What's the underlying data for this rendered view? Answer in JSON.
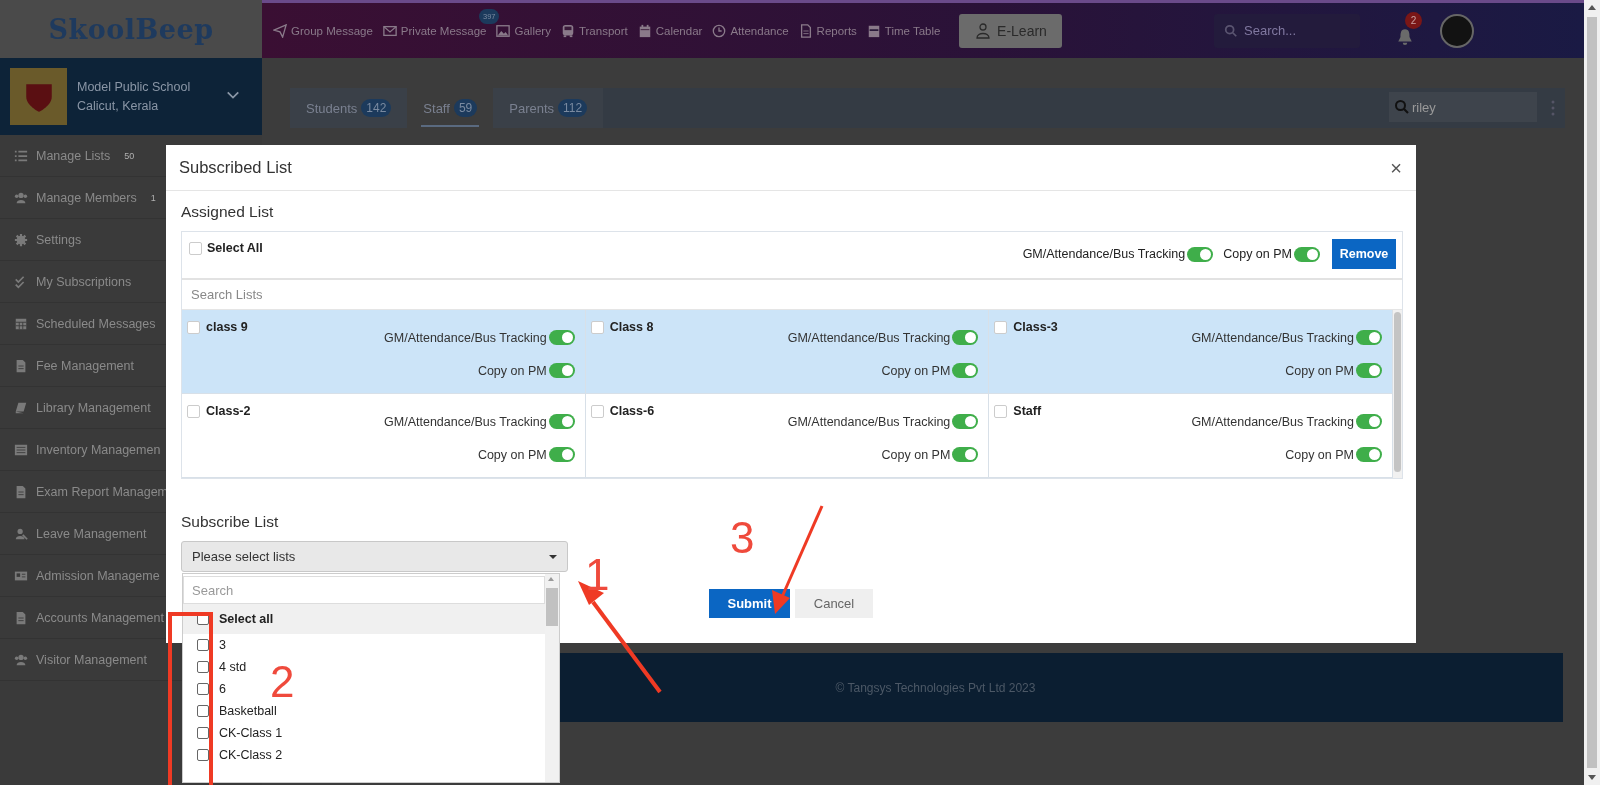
{
  "header": {
    "logo": "SkoolBeep",
    "nav": [
      {
        "label": "Group Message"
      },
      {
        "label": "Private Message",
        "badge": "397"
      },
      {
        "label": "Gallery"
      },
      {
        "label": "Transport"
      },
      {
        "label": "Calendar"
      },
      {
        "label": "Attendance"
      },
      {
        "label": "Reports"
      },
      {
        "label": "Time Table"
      }
    ],
    "elearn": "E-Learn",
    "search": {
      "placeholder": "Search..."
    },
    "notifications": "2"
  },
  "school": {
    "name": "Model Public School",
    "location": "Calicut, Kerala"
  },
  "sidebar": {
    "items": [
      {
        "label": "Manage Lists",
        "count": "50"
      },
      {
        "label": "Manage Members",
        "count": "1"
      },
      {
        "label": "Settings"
      },
      {
        "label": "My Subscriptions"
      },
      {
        "label": "Scheduled Messages"
      },
      {
        "label": "Fee Management"
      },
      {
        "label": "Library Management"
      },
      {
        "label": "Inventory Managemen"
      },
      {
        "label": "Exam Report Managem"
      },
      {
        "label": "Leave Management"
      },
      {
        "label": "Admission Manageme"
      },
      {
        "label": "Accounts Management"
      },
      {
        "label": "Visitor Management"
      }
    ]
  },
  "tabs": [
    {
      "label": "Students",
      "count": "142",
      "selected": false
    },
    {
      "label": "Staff",
      "count": "59",
      "selected": true
    },
    {
      "label": "Parents",
      "count": "112",
      "selected": false
    }
  ],
  "member_search": {
    "value": "riley"
  },
  "footer": "© Tangsys Technologies Pvt Ltd 2023",
  "modal": {
    "title": "Subscribed List",
    "close": "×",
    "assigned_title": "Assigned List",
    "select_all": {
      "label": "Select All",
      "checked": false
    },
    "bulk_toggles": [
      {
        "label": "GM/Attendance/Bus Tracking",
        "on": true
      },
      {
        "label": "Copy on PM",
        "on": true
      }
    ],
    "remove": "Remove",
    "search": {
      "placeholder": "Search Lists"
    },
    "lists": [
      {
        "name": "class 9",
        "checked": false,
        "highlighted": true,
        "toggles": [
          {
            "label": "GM/Attendance/Bus Tracking",
            "on": true
          },
          {
            "label": "Copy on PM",
            "on": true
          }
        ]
      },
      {
        "name": "Class 8",
        "checked": false,
        "highlighted": true,
        "toggles": [
          {
            "label": "GM/Attendance/Bus Tracking",
            "on": true
          },
          {
            "label": "Copy on PM",
            "on": true
          }
        ]
      },
      {
        "name": "Class-3",
        "checked": false,
        "highlighted": true,
        "toggles": [
          {
            "label": "GM/Attendance/Bus Tracking",
            "on": true
          },
          {
            "label": "Copy on PM",
            "on": true
          }
        ]
      },
      {
        "name": "Class-2",
        "checked": false,
        "highlighted": false,
        "toggles": [
          {
            "label": "GM/Attendance/Bus Tracking",
            "on": true
          },
          {
            "label": "Copy on PM",
            "on": true
          }
        ]
      },
      {
        "name": "Class-6",
        "checked": false,
        "highlighted": false,
        "toggles": [
          {
            "label": "GM/Attendance/Bus Tracking",
            "on": true
          },
          {
            "label": "Copy on PM",
            "on": true
          }
        ]
      },
      {
        "name": "Staff",
        "checked": false,
        "highlighted": false,
        "toggles": [
          {
            "label": "GM/Attendance/Bus Tracking",
            "on": true
          },
          {
            "label": "Copy on PM",
            "on": true
          }
        ]
      }
    ],
    "subscribe_title": "Subscribe List",
    "dropdown": {
      "placeholder": "Please select lists",
      "search_placeholder": "Search",
      "options": [
        {
          "kind": "select-all",
          "label": "Select all",
          "checked": false
        },
        {
          "kind": "option",
          "label": "3",
          "checked": false
        },
        {
          "kind": "option",
          "label": "4 std",
          "checked": false
        },
        {
          "kind": "option",
          "label": "6",
          "checked": false
        },
        {
          "kind": "option",
          "label": "Basketball",
          "checked": false
        },
        {
          "kind": "option",
          "label": "CK-Class 1",
          "checked": false
        },
        {
          "kind": "option",
          "label": "CK-Class 2",
          "checked": false
        }
      ]
    },
    "buttons": [
      {
        "kind": "primary",
        "label": "Submit"
      },
      {
        "kind": "secondary",
        "label": "Cancel"
      }
    ]
  },
  "annotations": [
    "1",
    "2",
    "3"
  ]
}
